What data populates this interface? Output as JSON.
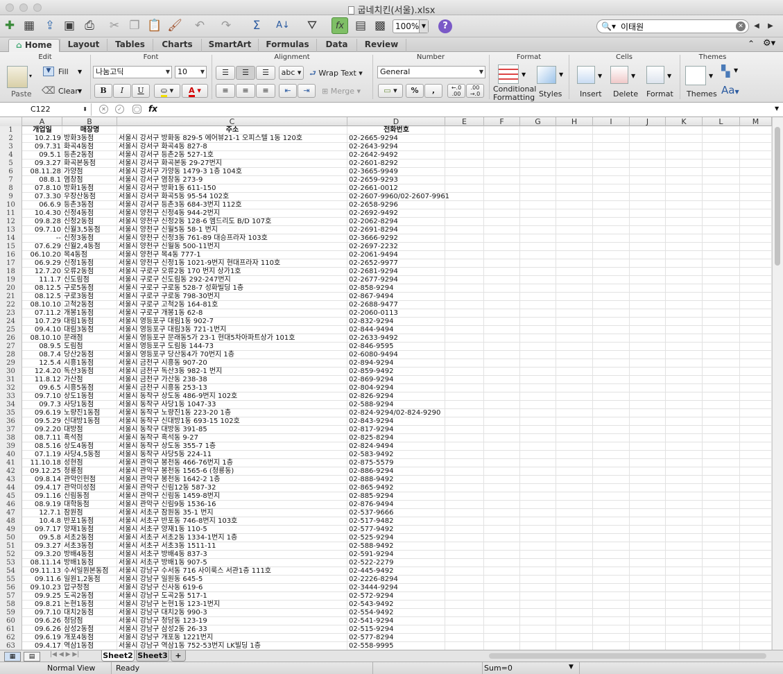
{
  "window": {
    "title": "굽네치킨(서울).xlsx"
  },
  "toolbar": {
    "zoom": "100%",
    "search_value": "이태원"
  },
  "tabs": [
    "Home",
    "Layout",
    "Tables",
    "Charts",
    "SmartArt",
    "Formulas",
    "Data",
    "Review"
  ],
  "ribbon": {
    "groups": {
      "edit": "Edit",
      "font": "Font",
      "alignment": "Alignment",
      "number": "Number",
      "format": "Format",
      "cells": "Cells",
      "themes": "Themes"
    },
    "paste": "Paste",
    "fill": "Fill",
    "clear": "Clear",
    "font_name": "나눔고딕",
    "font_size": "10",
    "bold": "B",
    "italic": "I",
    "underline": "U",
    "font_color_glyph": "A",
    "wrap_text": "Wrap Text",
    "merge": "Merge",
    "abc": "abc",
    "number_format": "General",
    "percent": "%",
    "comma": ",",
    "dec_inc": "←.0 .00",
    "dec_dec": ".00 →.0",
    "conditional_formatting_1": "Conditional",
    "conditional_formatting_2": "Formatting",
    "styles": "Styles",
    "insert": "Insert",
    "delete": "Delete",
    "format_btn": "Format",
    "themes_btn": "Themes",
    "aa_btn": "Aa"
  },
  "formula_bar": {
    "cell_ref": "C122",
    "fx": "fx",
    "content": ""
  },
  "columns": [
    "A",
    "B",
    "C",
    "D",
    "E",
    "F",
    "G",
    "H",
    "I",
    "J",
    "K",
    "L",
    "M"
  ],
  "rows": [
    {
      "n": "1",
      "a": "개업일",
      "b": "매장명",
      "c": "주소",
      "d": "전화번호"
    },
    {
      "n": "2",
      "a": "10.2.19",
      "b": "방화3동점",
      "c": "서울시 강서구 방화동 829-5 에어뷰21-1 오피스텔 1동 120호",
      "d": "02-2665-9294"
    },
    {
      "n": "3",
      "a": "09.7.31",
      "b": "화곡4동점",
      "c": "서울시 강서구 화곡4동 827-8",
      "d": "02-2643-9294"
    },
    {
      "n": "4",
      "a": "09.5.1",
      "b": "등촌2동점",
      "c": "서울시 강서구 등촌2동 527-1호",
      "d": "02-2642-9492"
    },
    {
      "n": "5",
      "a": "09.3.27",
      "b": "화곡본동점",
      "c": "서울시 강서구 화곡본동 29-27번지",
      "d": "02-2601-8292"
    },
    {
      "n": "6",
      "a": "08.11.28",
      "b": "가양점",
      "c": "서울시 강서구 가양동 1479-3 1층 104호",
      "d": "02-3665-9949"
    },
    {
      "n": "7",
      "a": "08.8.1",
      "b": "염창점",
      "c": "서울시 강서구 염창동 273-9",
      "d": "02-2659-9293"
    },
    {
      "n": "8",
      "a": "07.8.10",
      "b": "방화1동점",
      "c": "서울시 강서구 방화1동 611-150",
      "d": "02-2661-0012"
    },
    {
      "n": "9",
      "a": "07.3.30",
      "b": "우장산동점",
      "c": "서울시 강서구 화곡5동 95-54 102호",
      "d": "02-2607-9960/02-2607-9961"
    },
    {
      "n": "10",
      "a": "06.6.9",
      "b": "등촌3동점",
      "c": "서울시 강서구 등촌3동 684-3번지 112호",
      "d": "02-2658-9296"
    },
    {
      "n": "11",
      "a": "10.4.30",
      "b": "신정4동점",
      "c": "서울시 양천구 신정4동 944-2번지",
      "d": "02-2692-9492"
    },
    {
      "n": "12",
      "a": "09.8.28",
      "b": "신정2동점",
      "c": "서울시 양천구 신정2동 128-6 엠드리도 B/D 107호",
      "d": "02-2062-8294"
    },
    {
      "n": "13",
      "a": "09.7.10",
      "b": "신월3,5동점",
      "c": "서울시 양천구 신월5동 58-1 번지",
      "d": "02-2691-8294"
    },
    {
      "n": "14",
      "a": "--",
      "b": "신정3동점",
      "c": "서울시 양천구 신정3동 761-89 대승프라자 103호",
      "d": "02-3666-9292"
    },
    {
      "n": "15",
      "a": "07.6.29",
      "b": "신월2,4동점",
      "c": "서울시 양천구 신월동 500-11번지",
      "d": "02-2697-2232"
    },
    {
      "n": "16",
      "a": "06.10.20",
      "b": "목4동점",
      "c": "서울시 양천구 목4동 777-1",
      "d": "02-2061-9494"
    },
    {
      "n": "17",
      "a": "06.9.29",
      "b": "신정1동점",
      "c": "서울시 양천구 신정1동 1021-9번지 현대프라자 110호",
      "d": "02-2652-9977"
    },
    {
      "n": "18",
      "a": "12.7.20",
      "b": "오류2동점",
      "c": "서울시 구로구 오류2동 170 번지 상가1호",
      "d": "02-2681-9294"
    },
    {
      "n": "19",
      "a": "11.1.7",
      "b": "신도림점",
      "c": "서울시 구로구 신도림동 292-247번지",
      "d": "02-2677-9294"
    },
    {
      "n": "20",
      "a": "08.12.5",
      "b": "구로5동점",
      "c": "서울시 구로구 구로동 528-7 성화빌딩 1층",
      "d": "02-858-9294"
    },
    {
      "n": "21",
      "a": "08.12.5",
      "b": "구로3동점",
      "c": "서울시 구로구 구로동 798-30번지",
      "d": "02-867-9494"
    },
    {
      "n": "22",
      "a": "08.10.10",
      "b": "고척2동점",
      "c": "서울시 구로구 고척2동 164-81호",
      "d": "02-2688-9477"
    },
    {
      "n": "23",
      "a": "07.11.2",
      "b": "개봉1동점",
      "c": "서울시 구로구 개봉1동 62-8",
      "d": "02-2060-0113"
    },
    {
      "n": "24",
      "a": "10.7.29",
      "b": "대림1동점",
      "c": "서울시 영등포구 대림1동 902-7",
      "d": "02-832-9294"
    },
    {
      "n": "25",
      "a": "09.4.10",
      "b": "대림3동점",
      "c": "서울시 영등포구 대림3동 721-1번지",
      "d": "02-844-9494"
    },
    {
      "n": "26",
      "a": "08.10.10",
      "b": "문래점",
      "c": "서울시 영등포구 문래동5가 23-1 현대5차아파트상가 101호",
      "d": "02-2633-9492"
    },
    {
      "n": "27",
      "a": "08.9.5",
      "b": "도림점",
      "c": "서울시 영등포구 도림동 144-73",
      "d": "02-846-9595"
    },
    {
      "n": "28",
      "a": "08.7.4",
      "b": "당산2동점",
      "c": "서울시 영등포구 당산동4가 70번지 1층",
      "d": "02-6080-9494"
    },
    {
      "n": "29",
      "a": "12.5.4",
      "b": "시흥1동점",
      "c": "서울시 금천구 시흥동 907-20",
      "d": "02-894-9294"
    },
    {
      "n": "30",
      "a": "12.4.20",
      "b": "독산3동점",
      "c": "서울시 금천구 독산3동 982-1 번지",
      "d": "02-859-9492"
    },
    {
      "n": "31",
      "a": "11.8.12",
      "b": "가산점",
      "c": "서울시 금천구 가산동 238-38",
      "d": "02-869-9294"
    },
    {
      "n": "32",
      "a": "09.6.5",
      "b": "시흥5동점",
      "c": "서울시 금천구 시흥동 253-13",
      "d": "02-804-9294"
    },
    {
      "n": "33",
      "a": "09.7.10",
      "b": "상도1동점",
      "c": "서울시 동작구 상도동 486-9번지 102호",
      "d": "02-826-9294"
    },
    {
      "n": "34",
      "a": "09.7.3",
      "b": "사당1동점",
      "c": "서울시 동작구 사당1동 1047-33",
      "d": "02-588-9294"
    },
    {
      "n": "35",
      "a": "09.6.19",
      "b": "노량진1동점",
      "c": "서울시 동작구 노량진1동 223-20 1층",
      "d": "02-824-9294/02-824-9290"
    },
    {
      "n": "36",
      "a": "09.5.29",
      "b": "신대방1동점",
      "c": "서울시 동작구 신대방1동 693-15 102호",
      "d": "02-843-9294"
    },
    {
      "n": "37",
      "a": "09.2.20",
      "b": "대방점",
      "c": "서울시 동작구 대방동 391-85",
      "d": "02-817-9294"
    },
    {
      "n": "38",
      "a": "08.7.11",
      "b": "흑석점",
      "c": "서울시 동작구 흑석동 9-27",
      "d": "02-825-8294"
    },
    {
      "n": "39",
      "a": "08.5.16",
      "b": "상도4동점",
      "c": "서울시 동작구 상도동 355-7 1층",
      "d": "02-824-9494"
    },
    {
      "n": "40",
      "a": "07.1.19",
      "b": "사당4,5동점",
      "c": "서울시 동작구 사당5동 224-11",
      "d": "02-583-9492"
    },
    {
      "n": "41",
      "a": "11.10.18",
      "b": "성현점",
      "c": "서울시 관악구 봉천동 466-76번지 1층",
      "d": "02-875-5579"
    },
    {
      "n": "42",
      "a": "09.12.25",
      "b": "청룡점",
      "c": "서울시 관악구 봉천동 1565-6 (청룡동)",
      "d": "02-886-9294"
    },
    {
      "n": "43",
      "a": "09.8.14",
      "b": "관악인헌점",
      "c": "서울시 관악구 봉천동 1642-2 1층",
      "d": "02-888-9492"
    },
    {
      "n": "44",
      "a": "09.4.17",
      "b": "관악미성점",
      "c": "서울시 관악구 신림12동 587-32",
      "d": "02-865-9492"
    },
    {
      "n": "45",
      "a": "09.1.16",
      "b": "신림동점",
      "c": "서울시 관악구 신림동 1459-8번지",
      "d": "02-885-9294"
    },
    {
      "n": "46",
      "a": "08.9.19",
      "b": "대학동점",
      "c": "서울시 관악구 신림9동 1536-16",
      "d": "02-876-9494"
    },
    {
      "n": "47",
      "a": "12.7.1",
      "b": "잠원점",
      "c": "서울시 서초구 잠원동 35-1 번지",
      "d": "02-537-9666"
    },
    {
      "n": "48",
      "a": "10.4.8",
      "b": "반포1동점",
      "c": "서울시 서초구 반포동 746-8번지 103호",
      "d": "02-517-9482"
    },
    {
      "n": "49",
      "a": "09.7.17",
      "b": "양재1동점",
      "c": "서울시 서초구 양재1동 110-5",
      "d": "02-577-9492"
    },
    {
      "n": "50",
      "a": "09.5.8",
      "b": "서초2동점",
      "c": "서울시 서초구 서초2동 1334-1번지 1층",
      "d": "02-525-9294"
    },
    {
      "n": "51",
      "a": "09.3.27",
      "b": "서초3동점",
      "c": "서울시 서초구 서초3동 1511-11",
      "d": "02-588-9492"
    },
    {
      "n": "52",
      "a": "09.3.20",
      "b": "방배4동점",
      "c": "서울시 서초구 방배4동 837-3",
      "d": "02-591-9294"
    },
    {
      "n": "53",
      "a": "08.11.14",
      "b": "방배1동점",
      "c": "서울시 서초구 방배1동 907-5",
      "d": "02-522-2279"
    },
    {
      "n": "54",
      "a": "09.11.13",
      "b": "수서일원본동점",
      "c": "서울시 강남구 수서동 716 사이룩스 서관1층 111호",
      "d": "02-445-9492"
    },
    {
      "n": "55",
      "a": "09.11.6",
      "b": "일원1,2동점",
      "c": "서울시 강남구 일원동 645-5",
      "d": "02-2226-8294"
    },
    {
      "n": "56",
      "a": "09.10.23",
      "b": "압구정점",
      "c": "서울시 강남구 신사동 619-6",
      "d": "02-3444-9294"
    },
    {
      "n": "57",
      "a": "09.9.25",
      "b": "도곡2동점",
      "c": "서울시 강남구 도곡2동 517-1",
      "d": "02-572-9294"
    },
    {
      "n": "58",
      "a": "09.8.21",
      "b": "논현1동점",
      "c": "서울시 강남구 논현1동 123-1번지",
      "d": "02-543-9492"
    },
    {
      "n": "59",
      "a": "09.7.10",
      "b": "대치2동점",
      "c": "서울시 강남구 대치2동 990-3",
      "d": "02-554-9492"
    },
    {
      "n": "60",
      "a": "09.6.26",
      "b": "청담점",
      "c": "서울시 강남구 청담동 123-19",
      "d": "02-541-9294"
    },
    {
      "n": "61",
      "a": "09.6.26",
      "b": "삼성2동점",
      "c": "서울시 강남구 삼성2동 26-33",
      "d": "02-515-9294"
    },
    {
      "n": "62",
      "a": "09.6.19",
      "b": "개포4동점",
      "c": "서울시 강남구 개포동 1221번지",
      "d": "02-577-8294"
    },
    {
      "n": "63",
      "a": "09.4.17",
      "b": "역삼1동점",
      "c": "서울시 강남구 역삼1동 752-53번지 LK빌딩 1층",
      "d": "02-558-9995"
    }
  ],
  "sheets": [
    "Sheet2",
    "Sheet3"
  ],
  "add_sheet": "+",
  "status": {
    "view": "Normal View",
    "state": "Ready",
    "sum": "Sum=0"
  }
}
